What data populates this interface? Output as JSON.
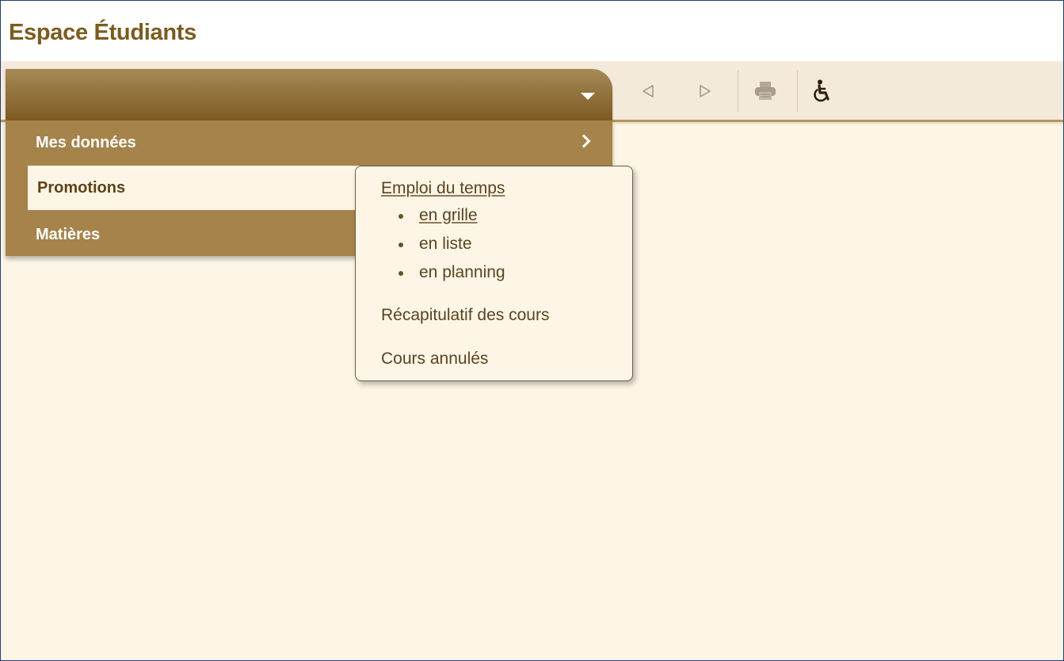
{
  "app": {
    "title": "Espace Étudiants"
  },
  "menu": {
    "items": [
      {
        "label": "Mes données",
        "has_submenu": true
      },
      {
        "label": "Promotions",
        "active": true
      },
      {
        "label": "Matières"
      }
    ]
  },
  "toolbar": {
    "buttons": [
      {
        "icon": "triangle-left-icon",
        "enabled": false
      },
      {
        "icon": "triangle-right-icon",
        "enabled": false
      },
      {
        "icon": "printer-icon",
        "enabled": false
      },
      {
        "icon": "accessibility-icon",
        "enabled": true
      }
    ]
  },
  "submenu": {
    "emploi_du_temps": "Emploi du temps",
    "views": [
      "en grille",
      "en liste",
      "en planning"
    ],
    "recapitulatif": "Récapitulatif des cours",
    "cours_annules": "Cours annulés"
  },
  "colors": {
    "title": "#7a5c1f",
    "menu_bg": "#a6834a",
    "page_bg": "#fdf5e6",
    "frame_border": "#1f3f6e"
  }
}
